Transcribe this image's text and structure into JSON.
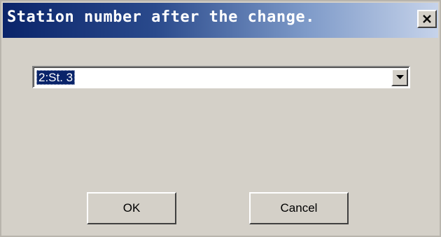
{
  "dialog": {
    "title": "Station number after the change.",
    "close_icon": "close-icon"
  },
  "station_select": {
    "selected_value": "2:St. 3",
    "dropdown_icon": "chevron-down-icon"
  },
  "buttons": {
    "ok_label": "OK",
    "cancel_label": "Cancel"
  },
  "colors": {
    "title_bar_start": "#0a246a",
    "title_bar_end": "#c6d3ea",
    "window_background": "#d4d0c8",
    "selection_highlight": "#0a246a"
  }
}
